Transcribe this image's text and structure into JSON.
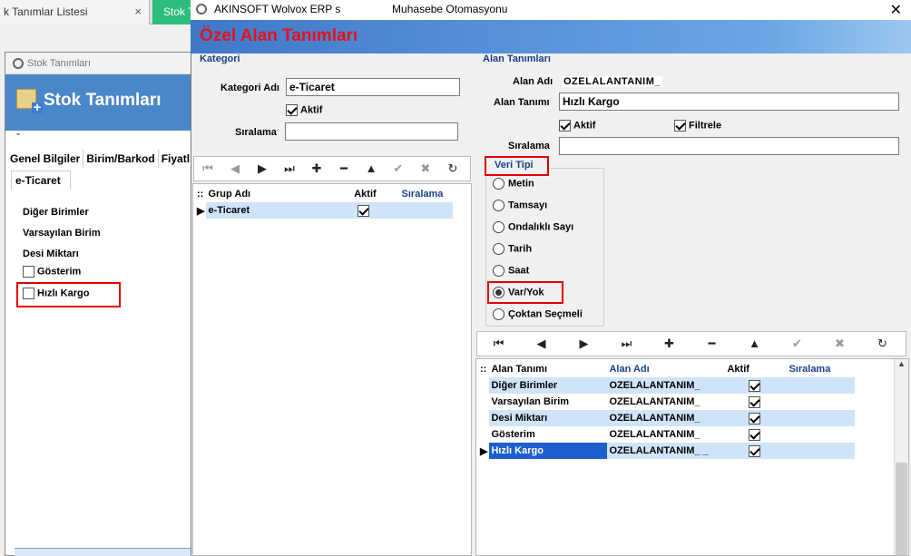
{
  "tabs": {
    "tab1": "k Tanımlar Listesi",
    "tab1_close": "×",
    "tab2": "Stok T"
  },
  "stok_window": {
    "title": "Stok Tanımları",
    "header": "Stok Tanımları",
    "dash": "-",
    "tabs": [
      "Genel Bilgiler",
      "Birim/Barkod",
      "Fiyatl"
    ],
    "subtab": "e-Ticaret",
    "labels": [
      "Diğer Birimler",
      "Varsayılan  Birim",
      "Desi Miktarı"
    ],
    "check1": "Gösterim",
    "check2": "Hızlı Kargo"
  },
  "dialog": {
    "title": "AKINSOFT Wolvox ERP s                 Muhasebe Otomasyonu",
    "close": "✕",
    "header": "Özel Alan Tanımları"
  },
  "kategori": {
    "section": "Kategori",
    "adi_label": "Kategori Adı",
    "adi_value": "e-Ticaret",
    "aktif_label": "Aktif",
    "siralama_label": "Sıralama",
    "siralama_value": "",
    "grid_headers": [
      "Grup Adı",
      "Aktif",
      "Sıralama"
    ],
    "grid_rows": [
      {
        "name": "e-Ticaret",
        "aktif": true,
        "siralama": ""
      }
    ]
  },
  "alan": {
    "section": "Alan Tanımları",
    "adi_label": "Alan Adı",
    "adi_value": "OZELALANTANIM_",
    "tanim_label": "Alan Tanımı",
    "tanim_value": "Hızlı Kargo",
    "aktif_label": "Aktif",
    "filtrele_label": "Filtrele",
    "siralama_label": "Sıralama",
    "siralama_value": "",
    "veri_tipi_label": "Veri Tipi",
    "veri_tipleri": [
      "Metin",
      "Tamsayı",
      "Ondalıklı Sayı",
      "Tarih",
      "Saat",
      "Var/Yok",
      "Çoktan Seçmeli"
    ],
    "selected_tip": "Var/Yok",
    "grid_headers": [
      "Alan Tanımı",
      "Alan Adı",
      "Aktif",
      "Sıralama"
    ],
    "grid_rows": [
      {
        "tanim": "Diğer Birimler",
        "adi": "OZELALANTANIM_",
        "aktif": true
      },
      {
        "tanim": "Varsayılan  Birim",
        "adi": "OZELALANTANIM_",
        "aktif": true
      },
      {
        "tanim": "Desi Miktarı",
        "adi": "OZELALANTANIM_",
        "aktif": true
      },
      {
        "tanim": "Gösterim",
        "adi": "OZELALANTANIM_",
        "aktif": true
      },
      {
        "tanim": "Hızlı Kargo",
        "adi": "OZELALANTANIM_ _",
        "aktif": true
      }
    ]
  },
  "toolbar_icons": [
    "first-icon",
    "prev-icon",
    "next-icon",
    "last-icon",
    "add-icon",
    "delete-icon",
    "up-icon",
    "confirm-icon",
    "cancel-icon",
    "refresh-icon"
  ],
  "colors": {
    "header_blue": "#3f78c8",
    "header_title_red": "#e8101a",
    "highlight_red": "#e00000",
    "selected_row": "#1e5fcf"
  }
}
